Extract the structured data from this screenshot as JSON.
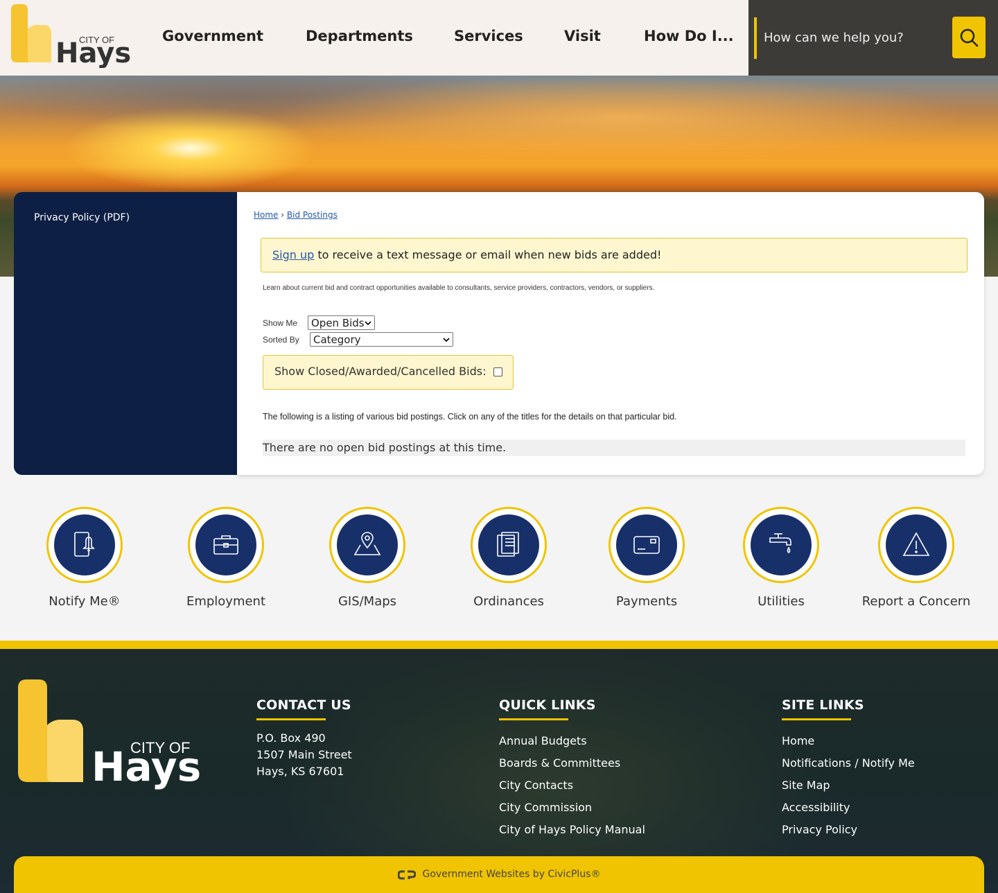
{
  "brand": {
    "city_of": "CITY OF",
    "name": "Hays",
    "colors": {
      "navy": "#0d1f45",
      "gold": "#f0c400",
      "light_gold": "#fdf6cf"
    }
  },
  "nav": {
    "items": [
      "Government",
      "Departments",
      "Services",
      "Visit",
      "How Do I..."
    ]
  },
  "search": {
    "placeholder": "How can we help you?",
    "icon": "search-icon"
  },
  "sidebar": {
    "link": "Privacy Policy (PDF)"
  },
  "breadcrumb": {
    "home": "Home",
    "separator": "›",
    "current": "Bid Postings"
  },
  "alert": {
    "link": "Sign up",
    "text": " to receive a text message or email when new bids are added!"
  },
  "intro": "Learn about current bid and contract opportunities available to consultants, service providers, contractors, vendors, or suppliers.",
  "filters": {
    "show_me_label": "Show Me",
    "show_me_value": "Open Bids",
    "sorted_by_label": "Sorted By",
    "sorted_by_value": "Category",
    "closed_label": "Show Closed/Awarded/Cancelled Bids:",
    "closed_checked": false
  },
  "listing": {
    "description": "The following is a listing of various bid postings. Click on any of the titles for the details on that particular bid.",
    "empty": "There are no open bid postings at this time."
  },
  "quick_icons": [
    {
      "label": "Notify Me®",
      "icon": "phone-bell-icon"
    },
    {
      "label": "Employment",
      "icon": "briefcase-icon"
    },
    {
      "label": "GIS/Maps",
      "icon": "map-pin-icon"
    },
    {
      "label": "Ordinances",
      "icon": "documents-icon"
    },
    {
      "label": "Payments",
      "icon": "card-icon"
    },
    {
      "label": "Utilities",
      "icon": "faucet-icon"
    },
    {
      "label": "Report a Concern",
      "icon": "warning-icon"
    }
  ],
  "footer": {
    "contact": {
      "heading": "CONTACT US",
      "lines": [
        "P.O. Box 490",
        "1507 Main Street",
        "Hays, KS 67601"
      ]
    },
    "quick_links": {
      "heading": "QUICK LINKS",
      "items": [
        "Annual Budgets",
        "Boards & Committees",
        "City Contacts",
        "City Commission",
        "City of Hays Policy Manual"
      ]
    },
    "site_links": {
      "heading": "SITE LINKS",
      "items": [
        "Home",
        "Notifications / Notify Me",
        "Site Map",
        "Accessibility",
        "Privacy Policy"
      ]
    },
    "credit": "Government Websites by CivicPlus®"
  }
}
